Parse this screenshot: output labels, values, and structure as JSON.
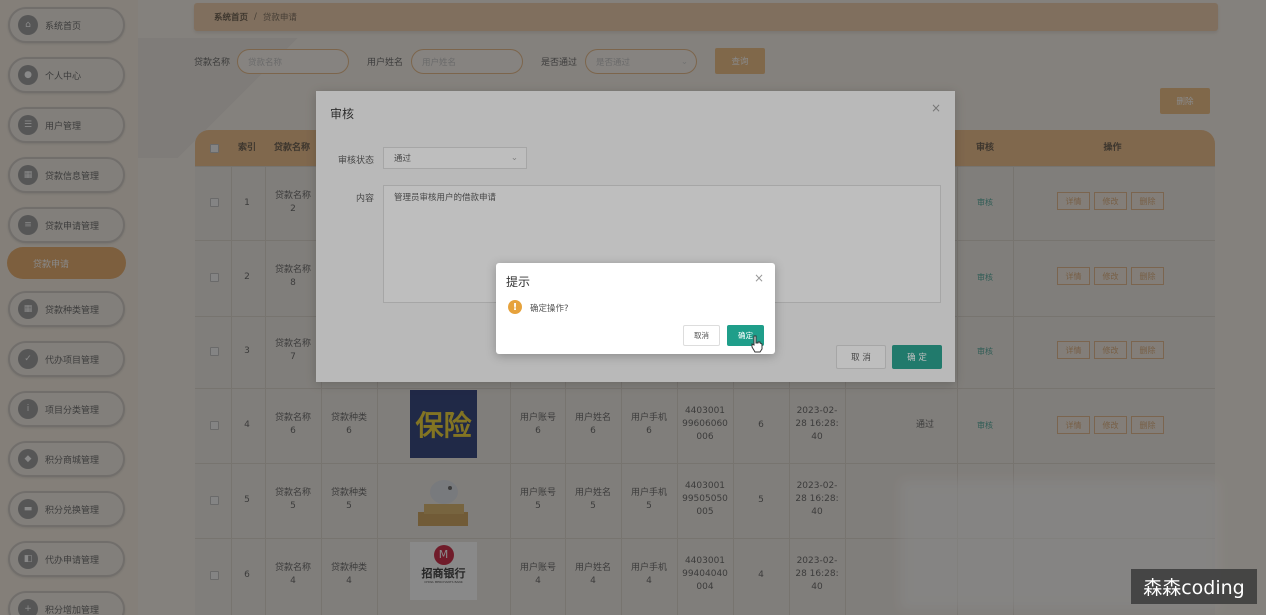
{
  "sidebar": {
    "items": [
      {
        "label": "系统首页",
        "icon": "home-icon"
      },
      {
        "label": "个人中心",
        "icon": "user-icon"
      },
      {
        "label": "用户管理",
        "icon": "users-icon"
      },
      {
        "label": "贷款信息管理",
        "icon": "grid-icon"
      },
      {
        "label": "贷款申请管理",
        "icon": "list-icon"
      },
      {
        "label": "贷款种类管理",
        "icon": "grid-icon"
      },
      {
        "label": "代办项目管理",
        "icon": "check-icon"
      },
      {
        "label": "项目分类管理",
        "icon": "info-icon"
      },
      {
        "label": "积分商城管理",
        "icon": "cart-icon"
      },
      {
        "label": "积分兑换管理",
        "icon": "chat-icon"
      },
      {
        "label": "代办申请管理",
        "icon": "tag-icon"
      },
      {
        "label": "积分增加管理",
        "icon": "plus-icon"
      }
    ],
    "subitem": "贷款申请"
  },
  "breadcrumb": {
    "home": "系统首页",
    "sep": "/",
    "current": "贷款申请"
  },
  "filters": {
    "loan_name_label": "贷款名称",
    "loan_name_placeholder": "贷款名称",
    "user_name_label": "用户姓名",
    "user_name_placeholder": "用户姓名",
    "passed_label": "是否通过",
    "passed_placeholder": "是否通过",
    "query": "查询",
    "delete": "删除"
  },
  "table": {
    "headers": {
      "index": "索引",
      "loan_name": "贷款名称",
      "audit": "审核",
      "actions": "操作"
    },
    "rows": [
      {
        "index": "1",
        "loan_name": "贷款名称\n2",
        "audit": "审核"
      },
      {
        "index": "2",
        "loan_name": "贷款名称\n8",
        "audit": "审核"
      },
      {
        "index": "3",
        "loan_name": "贷款名称\n7",
        "audit": "审核"
      },
      {
        "index": "4",
        "loan_name": "贷款名称\n6",
        "loan_type": "贷款种类\n6",
        "account": "用户账号\n6",
        "user": "用户姓名\n6",
        "phone": "用户手机\n6",
        "idno": "4403001\n99606060\n006",
        "num": "6",
        "time": "2023-02-\n28 16:28:\n40",
        "status": "通过",
        "audit": "审核"
      },
      {
        "index": "5",
        "loan_name": "贷款名称\n5",
        "loan_type": "贷款种类\n5",
        "account": "用户账号\n5",
        "user": "用户姓名\n5",
        "phone": "用户手机\n5",
        "idno": "4403001\n99505050\n005",
        "num": "5",
        "time": "2023-02-\n28 16:28:\n40"
      },
      {
        "index": "6",
        "loan_name": "贷款名称\n4",
        "loan_type": "贷款种类\n4",
        "account": "用户账号\n4",
        "user": "用户姓名\n4",
        "phone": "用户手机\n4",
        "idno": "4403001\n99404040\n004",
        "num": "4",
        "time": "2023-02-\n28 16:28:\n40"
      }
    ],
    "op": {
      "detail": "详情",
      "edit": "修改",
      "del": "删除"
    },
    "img_text": {
      "insurance": "保险",
      "bank": "招商银行",
      "bank_en": "CHINA MERCHANTS BANK"
    }
  },
  "dialog": {
    "title": "审核",
    "status_label": "审核状态",
    "status_value": "通过",
    "content_label": "内容",
    "content_value": "管理员审核用户的借款申请",
    "cancel": "取 消",
    "confirm": "确 定"
  },
  "message": {
    "title": "提示",
    "text": "确定操作?",
    "cancel": "取消",
    "confirm": "确定"
  },
  "watermark": "森森coding",
  "colors": {
    "accent": "#eab57c",
    "teal": "#1f9e8a",
    "warn": "#e6a23c"
  }
}
